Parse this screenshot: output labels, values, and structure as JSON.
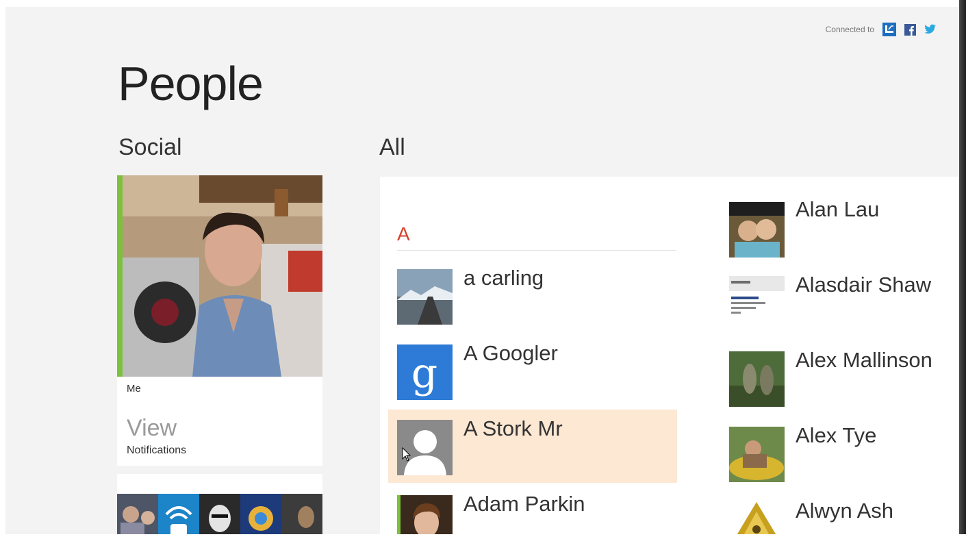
{
  "header": {
    "connected_label": "Connected to",
    "services": [
      "windows-live-icon",
      "facebook-icon",
      "twitter-icon"
    ]
  },
  "page_title": "People",
  "social": {
    "section_title": "Social",
    "me_label": "Me",
    "view_label": "View",
    "notifications_label": "Notifications"
  },
  "all": {
    "section_title": "All",
    "letter": "A",
    "contacts_col1": [
      {
        "name": "a carling"
      },
      {
        "name": "A Googler"
      },
      {
        "name": "A Stork Mr"
      },
      {
        "name": "Adam Parkin"
      }
    ],
    "contacts_col2": [
      {
        "name": "Alan Lau"
      },
      {
        "name": "Alasdair Shaw"
      },
      {
        "name": "Alex Mallinson"
      },
      {
        "name": "Alex Tye"
      },
      {
        "name": "Alwyn Ash"
      }
    ]
  },
  "colors": {
    "accent_green": "#7cc13d",
    "letter_red": "#d2432a",
    "highlight": "#fde8d4",
    "background": "#f3f3f3"
  }
}
